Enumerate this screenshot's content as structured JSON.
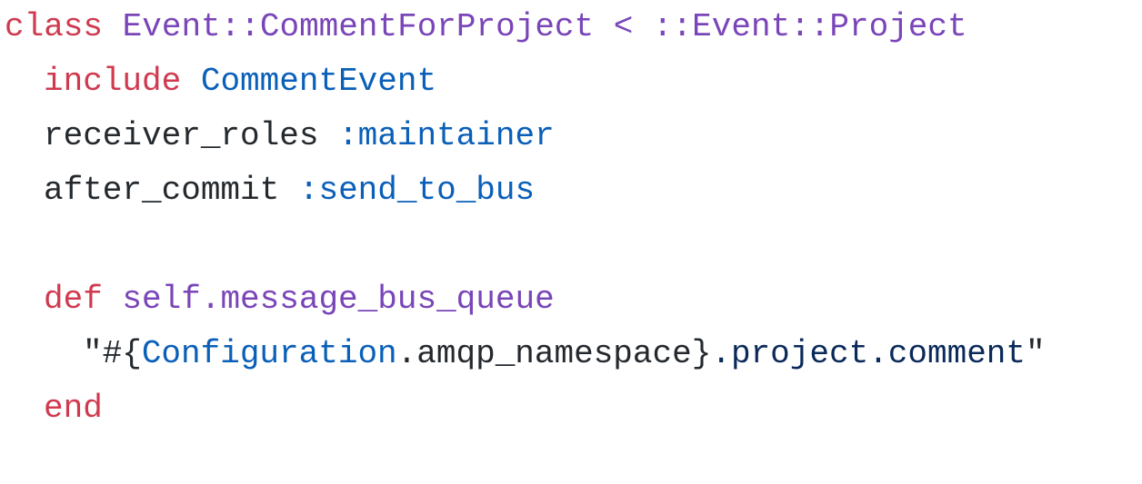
{
  "colors": {
    "keyword": "#cf3a4f",
    "class_name": "#7a45b8",
    "constant": "#0a5fb8",
    "text": "#24292e",
    "string": "#0b2a5a"
  },
  "code": {
    "line1": {
      "kw": "class",
      "name": "Event::CommentForProject",
      "op": "<",
      "parent": "::Event::Project"
    },
    "line2": {
      "kw": "include",
      "module": "CommentEvent"
    },
    "line3": {
      "method": "receiver_roles",
      "arg": ":maintainer"
    },
    "line4": {
      "method": "after_commit",
      "arg": ":send_to_bus"
    },
    "line6": {
      "kw": "def",
      "name": "self.message_bus_queue"
    },
    "line7": {
      "open": "\"#{",
      "const": "Configuration",
      "call": ".amqp_namespace",
      "close_interp": "}",
      "tail": ".project.comment",
      "close_quote": "\""
    },
    "line8": {
      "kw": "end"
    }
  }
}
